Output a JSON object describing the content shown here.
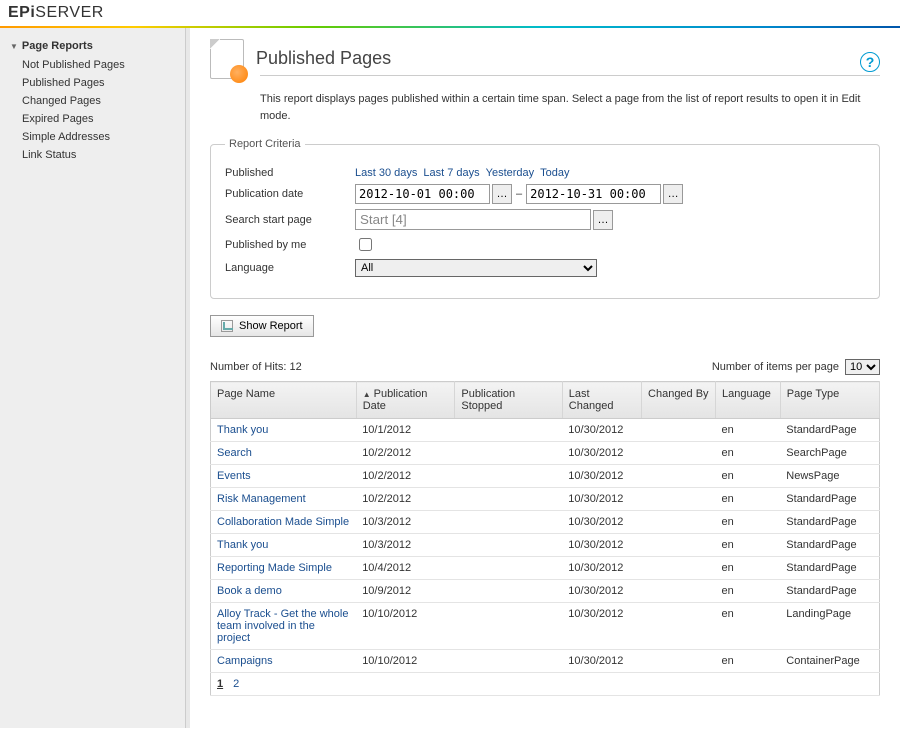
{
  "brand": "EPiSERVER",
  "sidebar": {
    "title": "Page Reports",
    "items": [
      "Not Published Pages",
      "Published Pages",
      "Changed Pages",
      "Expired Pages",
      "Simple Addresses",
      "Link Status"
    ]
  },
  "page": {
    "title": "Published Pages",
    "help_glyph": "?",
    "description": "This report displays pages published within a certain time span. Select a page from the list of report results to open it in Edit mode."
  },
  "criteria": {
    "legend": "Report Criteria",
    "labels": {
      "published": "Published",
      "publication_date": "Publication date",
      "search_start_page": "Search start page",
      "published_by_me": "Published by me",
      "language": "Language"
    },
    "quicklinks": [
      "Last 30 days",
      "Last 7 days",
      "Yesterday",
      "Today"
    ],
    "date_from": "2012-10-01 00:00",
    "date_to": "2012-10-31 00:00",
    "start_page": "Start [4]",
    "published_by_me": false,
    "language_selected": "All",
    "picker_glyph": "…",
    "browse_glyph": "…",
    "dash": "–"
  },
  "actions": {
    "show_report": "Show Report"
  },
  "results": {
    "hits_label": "Number of Hits: 12",
    "per_page_label": "Number of items per page",
    "per_page_value": "10",
    "columns": [
      "Page Name",
      "Publication Date",
      "Publication Stopped",
      "Last Changed",
      "Changed By",
      "Language",
      "Page Type"
    ],
    "sorted_column_index": 1,
    "rows": [
      {
        "name": "Thank you",
        "pub": "10/1/2012",
        "stop": "",
        "last": "10/30/2012",
        "by": "",
        "lang": "en",
        "type": "StandardPage"
      },
      {
        "name": "Search",
        "pub": "10/2/2012",
        "stop": "",
        "last": "10/30/2012",
        "by": "",
        "lang": "en",
        "type": "SearchPage"
      },
      {
        "name": "Events",
        "pub": "10/2/2012",
        "stop": "",
        "last": "10/30/2012",
        "by": "",
        "lang": "en",
        "type": "NewsPage"
      },
      {
        "name": "Risk Management",
        "pub": "10/2/2012",
        "stop": "",
        "last": "10/30/2012",
        "by": "",
        "lang": "en",
        "type": "StandardPage"
      },
      {
        "name": "Collaboration Made Simple",
        "pub": "10/3/2012",
        "stop": "",
        "last": "10/30/2012",
        "by": "",
        "lang": "en",
        "type": "StandardPage"
      },
      {
        "name": "Thank you",
        "pub": "10/3/2012",
        "stop": "",
        "last": "10/30/2012",
        "by": "",
        "lang": "en",
        "type": "StandardPage"
      },
      {
        "name": "Reporting Made Simple",
        "pub": "10/4/2012",
        "stop": "",
        "last": "10/30/2012",
        "by": "",
        "lang": "en",
        "type": "StandardPage"
      },
      {
        "name": "Book a demo",
        "pub": "10/9/2012",
        "stop": "",
        "last": "10/30/2012",
        "by": "",
        "lang": "en",
        "type": "StandardPage"
      },
      {
        "name": "Alloy Track - Get the whole team involved in the project",
        "pub": "10/10/2012",
        "stop": "",
        "last": "10/30/2012",
        "by": "",
        "lang": "en",
        "type": "LandingPage"
      },
      {
        "name": "Campaigns",
        "pub": "10/10/2012",
        "stop": "",
        "last": "10/30/2012",
        "by": "",
        "lang": "en",
        "type": "ContainerPage"
      }
    ],
    "pages": [
      "1",
      "2"
    ],
    "current_page": "1"
  }
}
